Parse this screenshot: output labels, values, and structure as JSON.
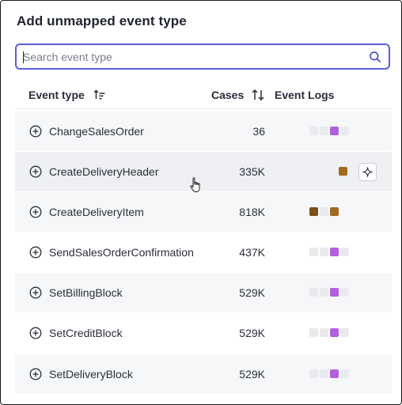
{
  "dialog": {
    "title": "Add unmapped event type"
  },
  "search": {
    "placeholder": "Search event type",
    "value": ""
  },
  "table": {
    "headers": {
      "event_type": "Event type",
      "cases": "Cases",
      "event_logs": "Event Logs"
    },
    "rows": [
      {
        "event_type": "ChangeSalesOrder",
        "cases": "36",
        "log_colors": [
          "#e9eaee",
          "#e9eaee",
          "#b060e0",
          "#e9eaee"
        ]
      },
      {
        "event_type": "CreateDeliveryHeader",
        "cases": "335K",
        "log_colors": [
          "#a06a20"
        ]
      },
      {
        "event_type": "CreateDeliveryItem",
        "cases": "818K",
        "log_colors": [
          "#7a4f1a",
          "#e9eaee",
          "#a06a20"
        ]
      },
      {
        "event_type": "SendSalesOrderConfirmation",
        "cases": "437K",
        "log_colors": [
          "#e9eaee",
          "#e9eaee",
          "#b060e0",
          "#e9eaee"
        ]
      },
      {
        "event_type": "SetBillingBlock",
        "cases": "529K",
        "log_colors": [
          "#e9eaee",
          "#e9eaee",
          "#b060e0",
          "#e9eaee"
        ]
      },
      {
        "event_type": "SetCreditBlock",
        "cases": "529K",
        "log_colors": [
          "#e9eaee",
          "#e9eaee",
          "#b060e0",
          "#e9eaee"
        ]
      },
      {
        "event_type": "SetDeliveryBlock",
        "cases": "529K",
        "log_colors": [
          "#e9eaee",
          "#e9eaee",
          "#b060e0",
          "#e9eaee"
        ]
      }
    ]
  },
  "colors": {
    "accent": "#5b5fd6",
    "purple_log": "#b060e0",
    "brown_log": "#a06a20",
    "dark_brown_log": "#7a4f1a"
  },
  "icons": {
    "search": "search-icon",
    "sort_event": "sort-ascending-icon",
    "sort_cases": "sort-arrows-icon",
    "add": "plus-circle-icon",
    "ai": "sparkle-icon",
    "cursor": "hand-pointer-icon"
  }
}
